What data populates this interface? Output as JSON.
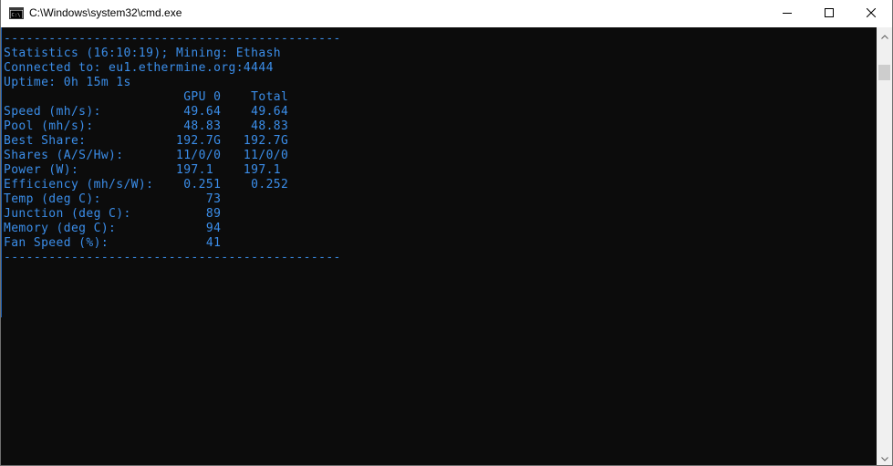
{
  "window": {
    "title": "C:\\Windows\\system32\\cmd.exe",
    "icon": "cmd-icon",
    "controls": [
      "minimize-icon",
      "maximize-icon",
      "close-icon"
    ]
  },
  "console": {
    "lines": [
      "---------------------------------------------",
      "Statistics (16:10:19); Mining: Ethash",
      "Connected to: eu1.ethermine.org:4444",
      "Uptime: 0h 15m 1s",
      "                        GPU 0    Total",
      "Speed (mh/s):           49.64    49.64",
      "Pool (mh/s):            48.83    48.83",
      "Best Share:            192.7G   192.7G",
      "Shares (A/S/Hw):       11/0/0   11/0/0",
      "Power (W):             197.1    197.1",
      "Efficiency (mh/s/W):    0.251    0.252",
      "Temp (deg C):              73",
      "Junction (deg C):          89",
      "Memory (deg C):            94",
      "Fan Speed (%):             41",
      "---------------------------------------------"
    ],
    "text_color": "#3b8eea",
    "background": "#0c0c0c"
  }
}
